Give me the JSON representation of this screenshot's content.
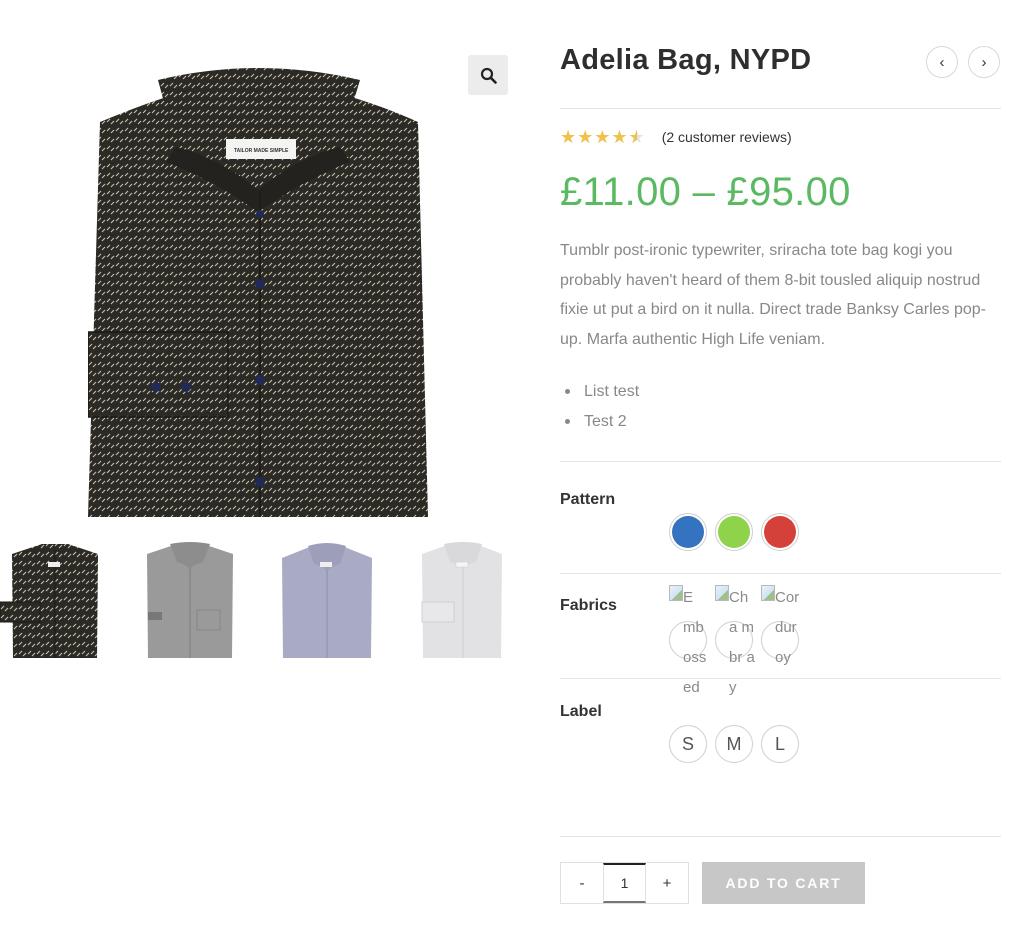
{
  "product": {
    "title": "Adelia Bag, NYPD",
    "rating": 4.5,
    "reviews_link": "(2 customer reviews)",
    "price": "£11.00 – £95.00",
    "description": "Tumblr post-ironic typewriter, sriracha tote bag kogi you probably haven't heard of them 8-bit tousled aliquip nostrud fixie ut put a bird on it nulla. Direct trade Banksy Carles pop-up. Marfa authentic High Life veniam.",
    "bullets": [
      "List test",
      "Test 2"
    ]
  },
  "gallery": {
    "label_text": "TAILOR MADE SIMPLE",
    "thumbnails": [
      "dark-pattern-shirt",
      "grey-shirt",
      "lavender-shirt",
      "white-shirt"
    ]
  },
  "icons": {
    "zoom": "magnifier-icon",
    "prev": "chevron-left-icon",
    "next": "chevron-right-icon",
    "stars": "star-icon"
  },
  "nav": {
    "prev_glyph": "‹",
    "next_glyph": "›"
  },
  "attributes": {
    "pattern": {
      "label": "Pattern",
      "colors": [
        "#3572c0",
        "#8fd34b",
        "#d5403a"
      ]
    },
    "fabrics": {
      "label": "Fabrics",
      "options": [
        "Embossed",
        "Chambray",
        "Corduroy"
      ],
      "broken_alt": [
        "E mb oss ed",
        "Cha mbr ay",
        "Cor dur oy"
      ]
    },
    "label": {
      "label": "Label",
      "options": [
        "S",
        "M",
        "L"
      ]
    }
  },
  "cart": {
    "minus": "-",
    "quantity": "1",
    "plus": "+",
    "add_to_cart": "ADD TO CART"
  },
  "colors": {
    "price_green": "#5bb961",
    "star_gold": "#efc24b",
    "cart_button": "#c7c7c7"
  }
}
